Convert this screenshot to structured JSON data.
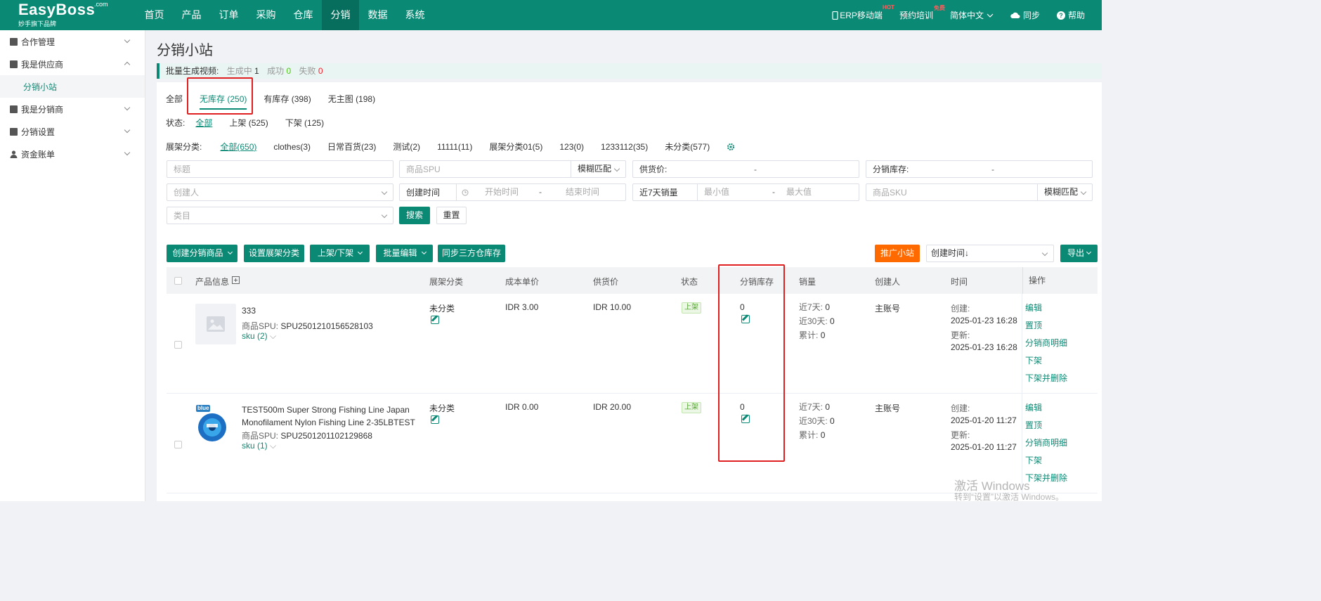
{
  "brand": {
    "name": "EasyBoss",
    "com": ".com",
    "slogan": "妙手旗下品牌"
  },
  "nav": [
    "首页",
    "产品",
    "订单",
    "采购",
    "仓库",
    "分销",
    "数据",
    "系统"
  ],
  "topright": {
    "erp": "ERP移动端",
    "hot": "HOT",
    "train": "预约培训",
    "free": "免费",
    "lang": "简体中文",
    "sync": "同步",
    "help": "帮助"
  },
  "sidebar": [
    {
      "label": "合作管理",
      "icon": "doc-icon"
    },
    {
      "label": "我是供应商",
      "icon": "doc-icon"
    },
    {
      "label": "分销小站",
      "sub": true
    },
    {
      "label": "我是分销商",
      "icon": "doc-icon"
    },
    {
      "label": "分销设置",
      "icon": "doc-icon"
    },
    {
      "label": "资金账单",
      "icon": "user-icon"
    }
  ],
  "page": {
    "title": "分销小站"
  },
  "alert": {
    "label": "批量生成视频:",
    "gen_label": "生成中",
    "gen_val": "1",
    "succ_label": "成功",
    "succ_val": "0",
    "fail_label": "失败",
    "fail_val": "0"
  },
  "tabs": [
    "全部",
    "无库存 (250)",
    "有库存 (398)",
    "无主图 (198)"
  ],
  "status": {
    "label": "状态:",
    "options": [
      "全部",
      "上架 (525)",
      "下架 (125)"
    ]
  },
  "category": {
    "label": "展架分类:",
    "options": [
      "全部(650)",
      "clothes(3)",
      "日常百货(23)",
      "测试(2)",
      "11111(11)",
      "展架分类01(5)",
      "123(0)",
      "1233112(35)",
      "未分类(577)"
    ]
  },
  "filters": {
    "title_ph": "标题",
    "spu_ph": "商品SPU",
    "fuzzy": "模糊匹配",
    "supply_label": "供货价:",
    "stock_label": "分销库存:",
    "dash": "-",
    "creator_ph": "创建人",
    "time_type": "创建时间",
    "start_ph": "开始时间",
    "end_ph": "结束时间",
    "sales_type": "近7天销量",
    "min_ph": "最小值",
    "max_ph": "最大值",
    "sku_ph": "商品SKU",
    "cat_ph": "类目",
    "search": "搜索",
    "reset": "重置"
  },
  "toolbar": {
    "create": "创建分销商品",
    "setcat": "设置展架分类",
    "shelf": "上架/下架",
    "batch": "批量编辑",
    "sync": "同步三方仓库存",
    "promote": "推广小站",
    "sort": "创建时间↓",
    "export": "导出"
  },
  "table": {
    "headers": [
      "产品信息",
      "展架分类",
      "成本单价",
      "供货价",
      "状态",
      "分销库存",
      "销量",
      "创建人",
      "时间",
      "操作"
    ],
    "rows": [
      {
        "title": "333",
        "spu_label": "商品SPU:",
        "spu": "SPU2501210156528103",
        "sku": "sku (2)",
        "category": "未分类",
        "cost": "IDR 3.00",
        "price": "IDR 10.00",
        "status": "上架",
        "stock": "0",
        "s7": "近7天:",
        "s7v": "0",
        "s30": "近30天:",
        "s30v": "0",
        "st": "累计:",
        "stv": "0",
        "creator": "主账号",
        "created_label": "创建:",
        "created": "2025-01-23 16:28",
        "updated_label": "更新:",
        "updated": "2025-01-23 16:28"
      },
      {
        "title": "TEST500m Super Strong Fishing Line Japan Monofilament Nylon Fishing Line 2-35LBTEST",
        "spu_label": "商品SPU:",
        "spu": "SPU2501201102129868",
        "sku": "sku (1)",
        "badge": "blue",
        "category": "未分类",
        "cost": "IDR 0.00",
        "price": "IDR 20.00",
        "status": "上架",
        "stock": "0",
        "s7": "近7天:",
        "s7v": "0",
        "s30": "近30天:",
        "s30v": "0",
        "st": "累计:",
        "stv": "0",
        "creator": "主账号",
        "created_label": "创建:",
        "created": "2025-01-20 11:27",
        "updated_label": "更新:",
        "updated": "2025-01-20 11:27"
      }
    ],
    "actions": [
      "编辑",
      "置顶",
      "分销商明细",
      "下架",
      "下架并删除"
    ]
  },
  "watermark": {
    "line1": "激活 Windows",
    "line2": "转到“设置”以激活 Windows。"
  }
}
